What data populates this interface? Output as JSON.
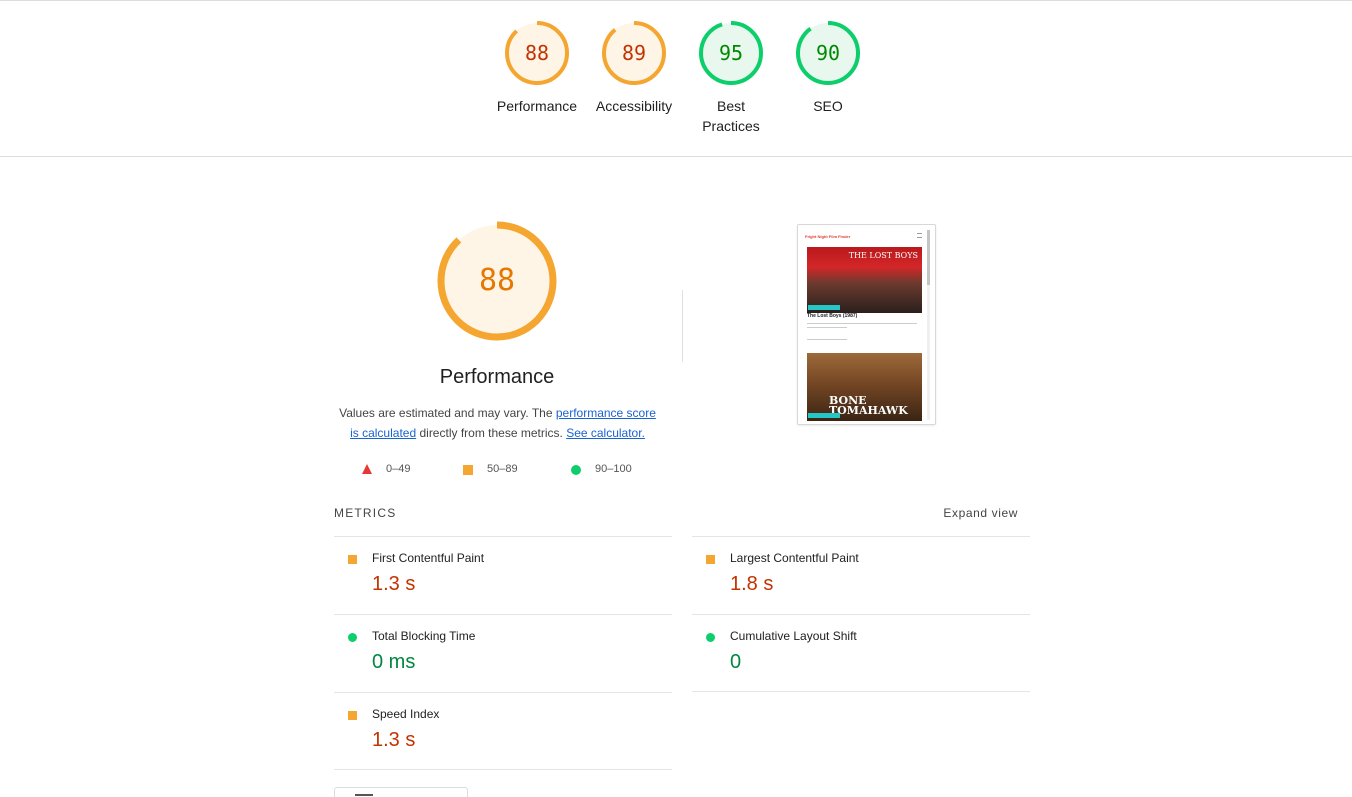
{
  "scores": [
    {
      "value": "88",
      "label": "Performance",
      "color": "#f4a630",
      "text_color": "#c33300",
      "fill": "#fff5e7"
    },
    {
      "value": "89",
      "label": "Accessibility",
      "color": "#f4a630",
      "text_color": "#c33300",
      "fill": "#fff5e7"
    },
    {
      "value": "95",
      "label": "Best Practices",
      "color": "#0cce6b",
      "text_color": "#008800",
      "fill": "#e8f8ee"
    },
    {
      "value": "90",
      "label": "SEO",
      "color": "#0cce6b",
      "text_color": "#008800",
      "fill": "#e8f8ee"
    }
  ],
  "performance": {
    "score": "88",
    "title": "Performance",
    "desc_prefix": "Values are estimated and may vary. The ",
    "desc_link1": "performance score is calculated",
    "desc_middle": " directly from these metrics. ",
    "desc_link2": "See calculator."
  },
  "legend": {
    "fail": "0–49",
    "average": "50–89",
    "pass": "90–100"
  },
  "thumbnail": {
    "site_title": "Fright Night Film Finder",
    "poster1_title": "THE LOST BOYS",
    "caption1": "The Lost Boys (1987)",
    "poster2_title": "BONE TOMAHAWK"
  },
  "metrics": {
    "heading": "METRICS",
    "expand_label": "Expand view",
    "items": [
      {
        "label": "First Contentful Paint",
        "value": "1.3 s",
        "rating": "average"
      },
      {
        "label": "Largest Contentful Paint",
        "value": "1.8 s",
        "rating": "average"
      },
      {
        "label": "Total Blocking Time",
        "value": "0 ms",
        "rating": "pass"
      },
      {
        "label": "Cumulative Layout Shift",
        "value": "0",
        "rating": "pass"
      },
      {
        "label": "Speed Index",
        "value": "1.3 s",
        "rating": "average"
      }
    ]
  }
}
